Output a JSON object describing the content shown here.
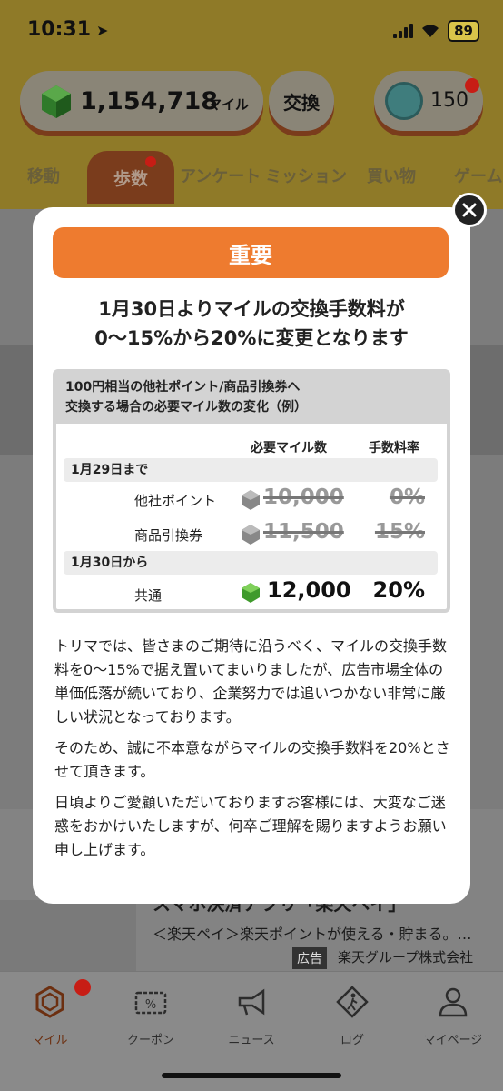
{
  "status_bar": {
    "time": "10:31",
    "battery": "89"
  },
  "header": {
    "miles_value": "1,154,718",
    "miles_unit": "マイル",
    "exchange_label": "交換",
    "coin_value": "150"
  },
  "tabs": [
    {
      "label": "移動"
    },
    {
      "label": "歩数"
    },
    {
      "label": "アンケート"
    },
    {
      "label": "ミッション"
    },
    {
      "label": "買い物"
    },
    {
      "label": "ゲーム"
    }
  ],
  "modal": {
    "banner": "重要",
    "headline_line1": "1月30日よりマイルの交換手数料が",
    "headline_line2": "0〜15%から20%に変更となります",
    "table": {
      "title_line1": "100円相当の他社ポイント/商品引換券へ",
      "title_line2": "交換する場合の必要マイル数の変化（例）",
      "col_miles": "必要マイル数",
      "col_fee": "手数料率",
      "period_before": "1月29日まで",
      "period_after": "1月30日から",
      "rows_before": [
        {
          "label": "他社ポイント",
          "miles": "10,000",
          "fee": "0%"
        },
        {
          "label": "商品引換券",
          "miles": "11,500",
          "fee": "15%"
        }
      ],
      "row_after": {
        "label": "共通",
        "miles": "12,000",
        "fee": "20%"
      }
    },
    "paragraph1": "トリマでは、皆さまのご期待に沿うべく、マイルの交換手数料を0〜15%で据え置いてまいりましたが、広告市場全体の単価低落が続いており、企業努力では追いつかない非常に厳しい状況となっております。",
    "paragraph2": "そのため、誠に不本意ながらマイルの交換手数料を20%とさせて頂きます。",
    "paragraph3": "日頃よりご愛顧いただいておりますお客様には、大変なご迷惑をおかけいたしますが、何卒ご理解を賜りますようお願い申し上げます。"
  },
  "ad": {
    "title": "スマホ決済アプリ「楽天ペイ」",
    "description": "＜楽天ペイ＞楽天ポイントが使える・貯まる。…",
    "badge": "広告",
    "company": "楽天グループ株式会社"
  },
  "bottom_nav": [
    {
      "label": "マイル",
      "icon": "miles-icon"
    },
    {
      "label": "クーポン",
      "icon": "coupon-icon"
    },
    {
      "label": "ニュース",
      "icon": "megaphone-icon"
    },
    {
      "label": "ログ",
      "icon": "walker-icon"
    },
    {
      "label": "マイページ",
      "icon": "person-icon"
    }
  ],
  "colors": {
    "accent": "#ee7b2f",
    "dimmed_header": "#8f7a28",
    "badge_red": "#c71d15"
  }
}
